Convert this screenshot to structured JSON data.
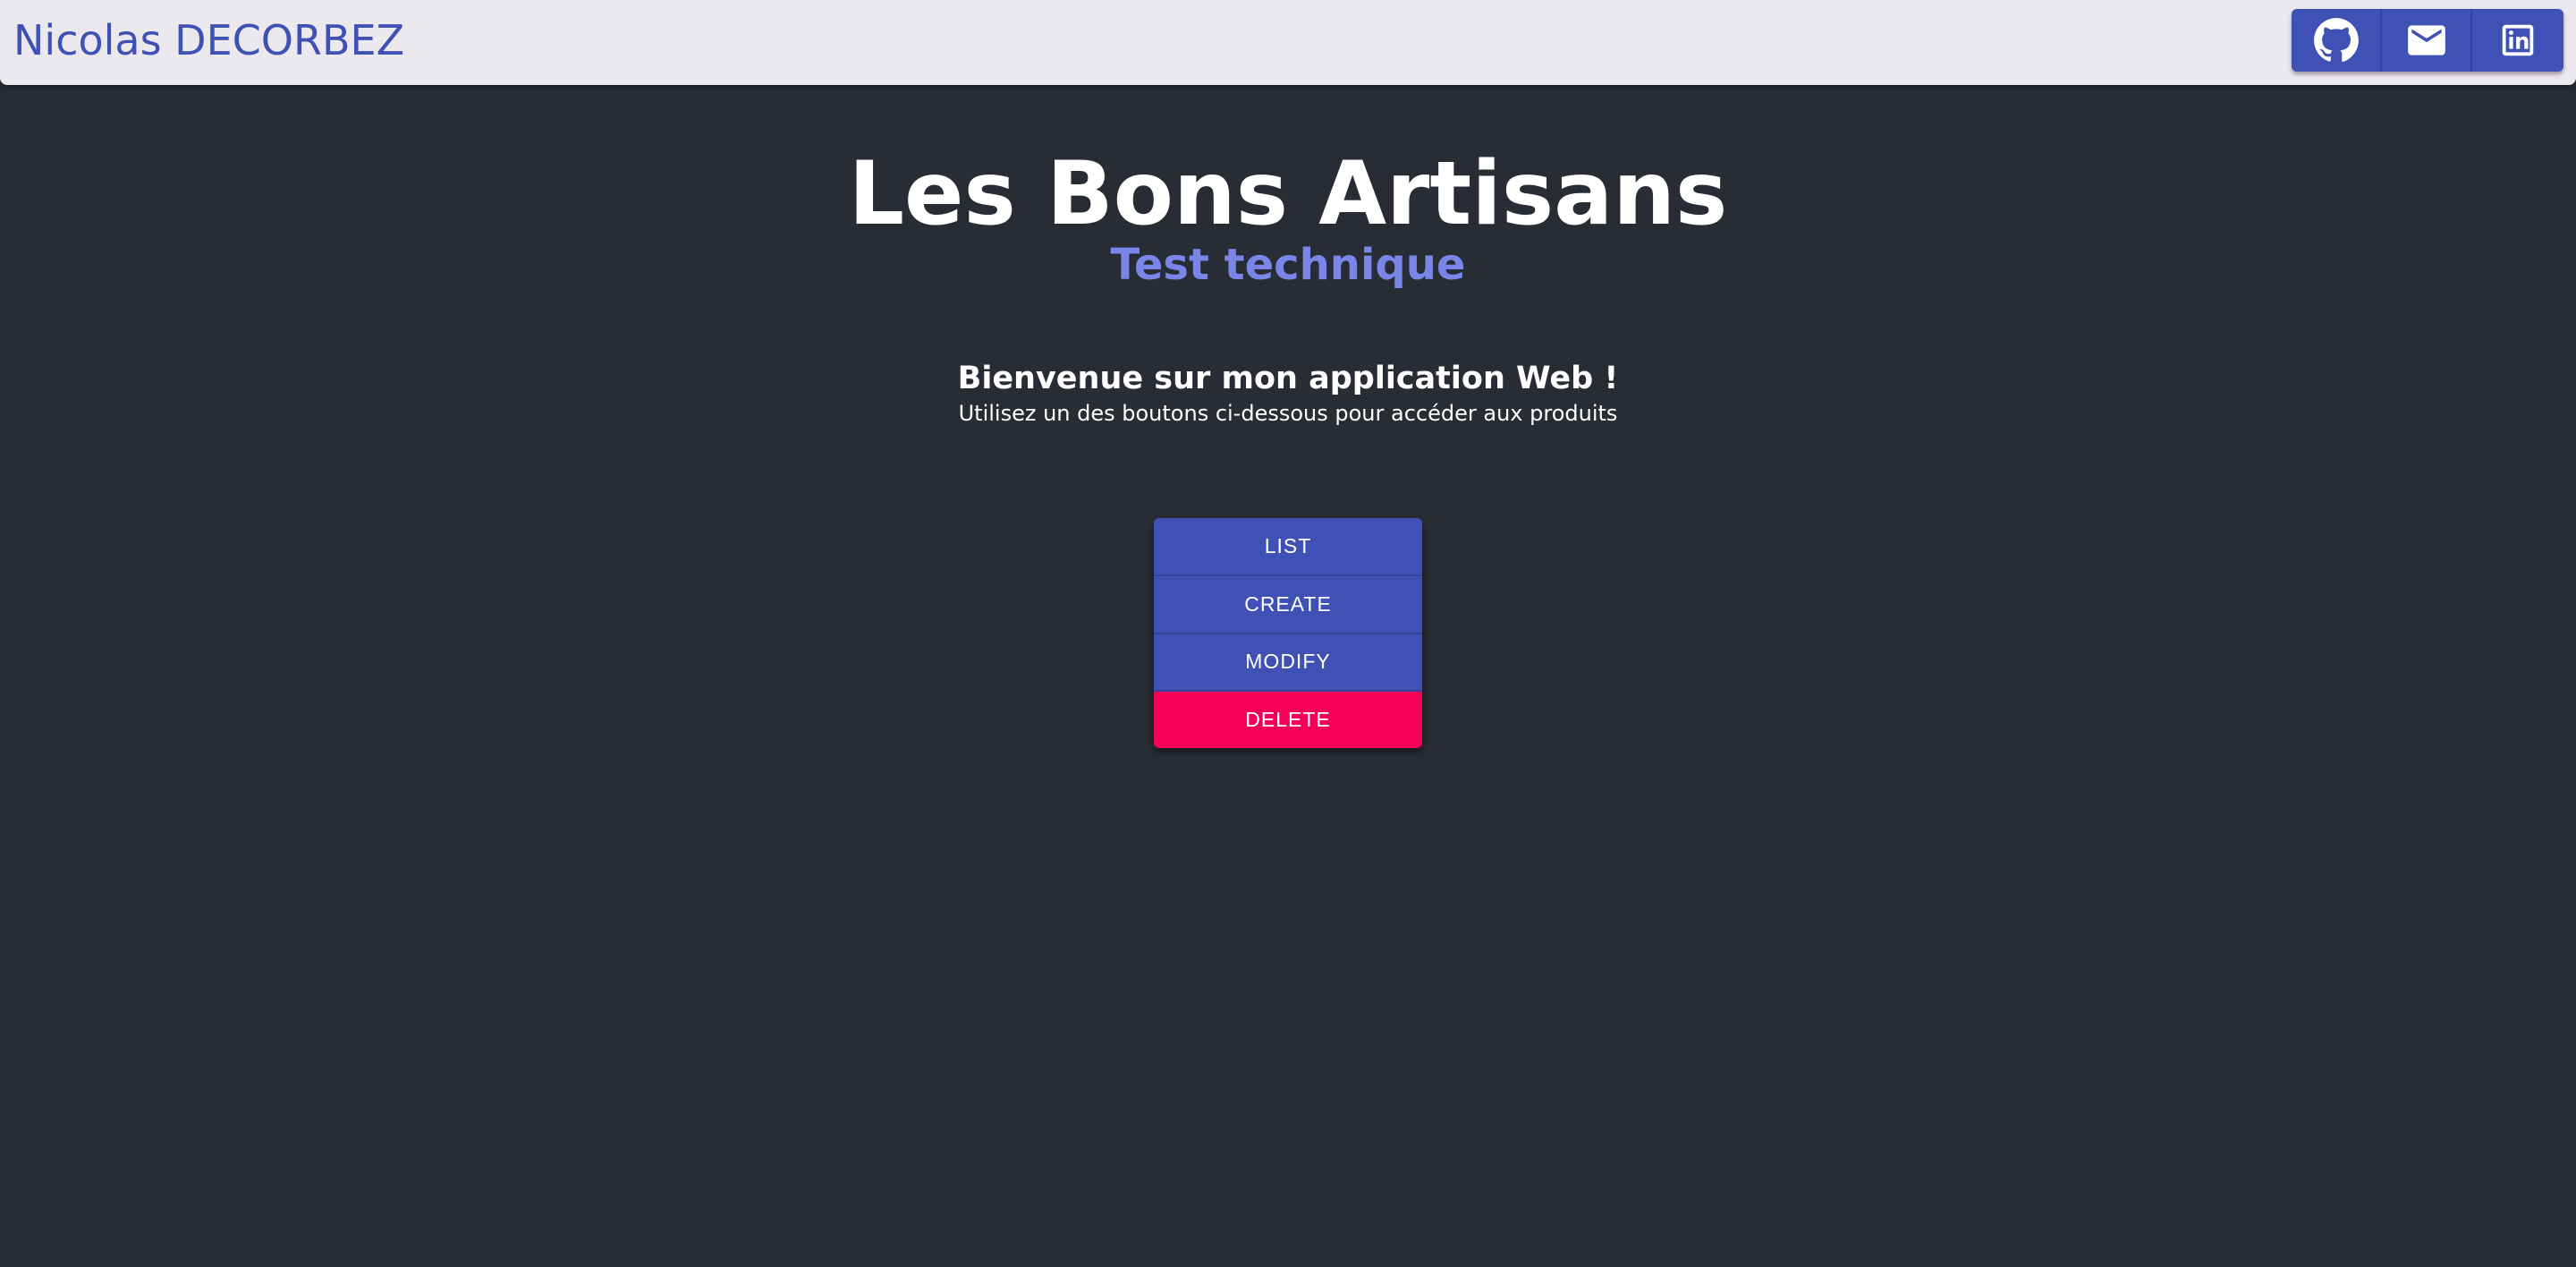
{
  "header": {
    "brand": "Nicolas DECORBEZ",
    "social": [
      {
        "icon": "github-icon"
      },
      {
        "icon": "mail-icon"
      },
      {
        "icon": "linkedin-icon"
      }
    ]
  },
  "hero": {
    "title": "Les Bons Artisans",
    "subtitle": "Test technique",
    "welcome": "Bienvenue sur mon application Web !",
    "instructions": "Utilisez un des boutons ci-dessous pour accéder aux produits"
  },
  "actions": {
    "list": "LIST",
    "create": "CREATE",
    "modify": "MODIFY",
    "delete": "DELETE"
  },
  "colors": {
    "background": "#282c34",
    "topbar": "#ebe8ee",
    "primary": "#3f51b5",
    "accent_subtitle": "#7986e8",
    "danger": "#f50057",
    "text": "#ffffff"
  }
}
